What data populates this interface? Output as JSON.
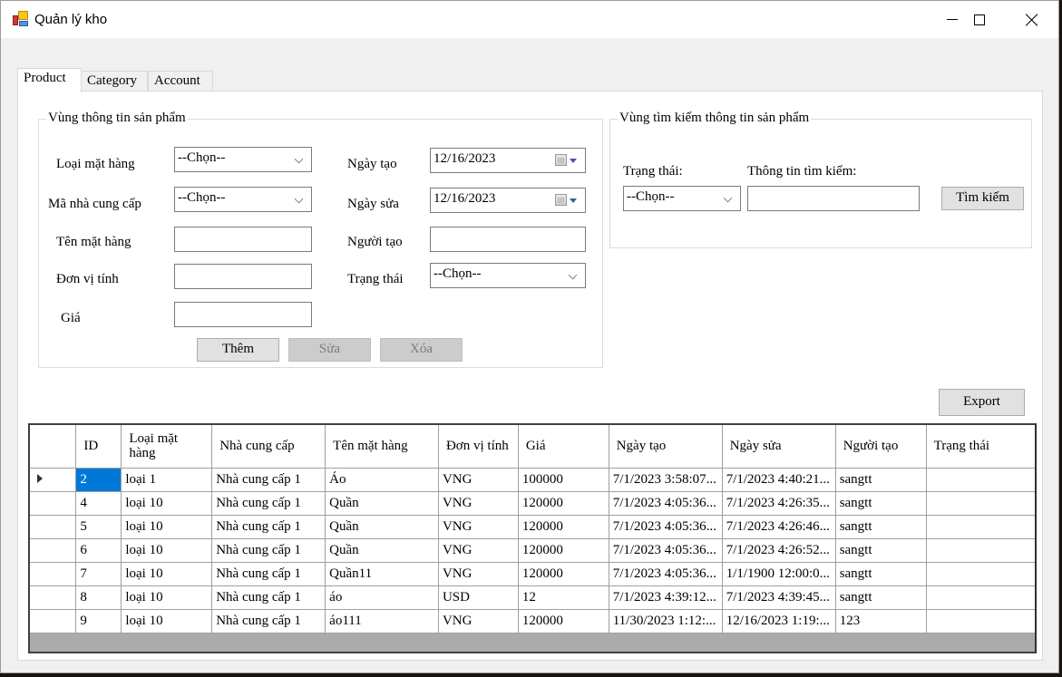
{
  "window": {
    "title": "Quản lý kho",
    "controls": {
      "minimize": "minimize",
      "maximize": "maximize",
      "close": "close"
    }
  },
  "tabs": [
    {
      "label": "Product",
      "active": true
    },
    {
      "label": "Category",
      "active": false
    },
    {
      "label": "Account",
      "active": false
    }
  ],
  "info_group": {
    "legend": "Vùng thông tin sản phẩm",
    "fields": {
      "loai_mat_hang": {
        "label": "Loại mặt hàng",
        "value": "--Chọn--"
      },
      "ma_nha_cung_cap": {
        "label": "Mã nhà cung cấp",
        "value": "--Chọn--"
      },
      "ten_mat_hang": {
        "label": "Tên mặt hàng",
        "value": ""
      },
      "don_vi_tinh": {
        "label": "Đơn vị tính",
        "value": ""
      },
      "gia": {
        "label": "Giá",
        "value": ""
      },
      "ngay_tao": {
        "label": "Ngày tạo",
        "value": "12/16/2023"
      },
      "ngay_sua": {
        "label": "Ngày sửa",
        "value": "12/16/2023"
      },
      "nguoi_tao": {
        "label": "Người tạo",
        "value": ""
      },
      "trang_thai": {
        "label": "Trạng thái",
        "value": "--Chọn--"
      }
    },
    "buttons": {
      "add": {
        "label": "Thêm",
        "enabled": true
      },
      "edit": {
        "label": "Sửa",
        "enabled": false
      },
      "delete": {
        "label": "Xóa",
        "enabled": false
      }
    }
  },
  "search_group": {
    "legend": "Vùng tìm kiếm thông tin sản phẩm",
    "status_label": "Trạng thái:",
    "status_value": "--Chọn--",
    "query_label": "Thông tin tìm kiếm:",
    "query_value": "",
    "search_button": "Tìm kiếm"
  },
  "export_button": "Export",
  "grid": {
    "columns": [
      "ID",
      "Loại mặt hàng",
      "Nhà cung cấp",
      "Tên mặt hàng",
      "Đơn vị tính",
      "Giá",
      "Ngày tạo",
      "Ngày sửa",
      "Người tạo",
      "Trạng thái"
    ],
    "rows": [
      [
        "2",
        "loại 1",
        "Nhà cung cấp 1",
        "Áo",
        "VNG",
        "100000",
        "7/1/2023 3:58:07...",
        "7/1/2023 4:40:21...",
        "sangtt",
        ""
      ],
      [
        "4",
        "loại 10",
        "Nhà cung cấp 1",
        "Quần",
        "VNG",
        "120000",
        "7/1/2023 4:05:36...",
        "7/1/2023 4:26:35...",
        "sangtt",
        ""
      ],
      [
        "5",
        "loại 10",
        "Nhà cung cấp 1",
        "Quần",
        "VNG",
        "120000",
        "7/1/2023 4:05:36...",
        "7/1/2023 4:26:46...",
        "sangtt",
        ""
      ],
      [
        "6",
        "loại 10",
        "Nhà cung cấp 1",
        "Quần",
        "VNG",
        "120000",
        "7/1/2023 4:05:36...",
        "7/1/2023 4:26:52...",
        "sangtt",
        ""
      ],
      [
        "7",
        "loại 10",
        "Nhà cung cấp 1",
        "Quần11",
        "VNG",
        "120000",
        "7/1/2023 4:05:36...",
        "1/1/1900 12:00:0...",
        "sangtt",
        ""
      ],
      [
        "8",
        "loại 10",
        "Nhà cung cấp 1",
        "áo",
        "USD",
        "12",
        "7/1/2023 4:39:12...",
        "7/1/2023 4:39:45...",
        "sangtt",
        ""
      ],
      [
        "9",
        "loại 10",
        "Nhà cung cấp 1",
        "áo111",
        "VNG",
        "120000",
        "11/30/2023 1:12:...",
        "12/16/2023 1:19:...",
        "123",
        ""
      ]
    ],
    "selected_row": 0,
    "selection_color": "#0078d7"
  }
}
